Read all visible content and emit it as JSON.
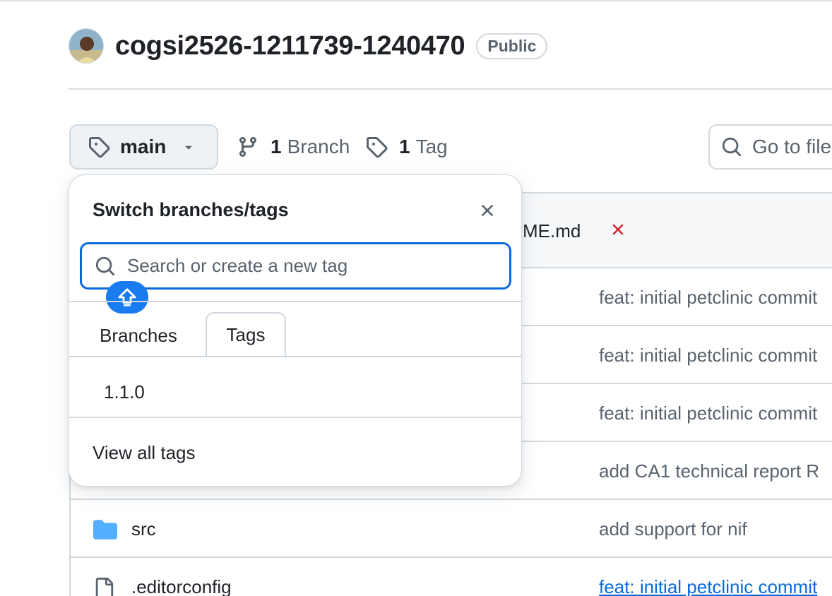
{
  "repo": {
    "name": "cogsi2526-1211739-1240470",
    "visibility": "Public"
  },
  "branch_bar": {
    "current_ref": "main",
    "branch_count": "1",
    "branch_label": "Branch",
    "tag_count": "1",
    "tag_label": "Tag",
    "goto_file_text": "Go to file"
  },
  "file_table": {
    "header_file": "ME.md",
    "rows": [
      {
        "name": "",
        "type": "",
        "message": "feat: initial petclinic commit",
        "link": false
      },
      {
        "name": "",
        "type": "",
        "message": "feat: initial petclinic commit",
        "link": false
      },
      {
        "name": "",
        "type": "",
        "message": "feat: initial petclinic commit",
        "link": false
      },
      {
        "name": "",
        "type": "",
        "message": "add CA1 technical report R",
        "link": false
      },
      {
        "name": "src",
        "type": "folder-icon",
        "message": "add support for nif",
        "link": false
      },
      {
        "name": ".editorconfig",
        "type": "file-icon",
        "message": "feat: initial petclinic commit",
        "link": true
      }
    ]
  },
  "dropdown": {
    "title": "Switch branches/tags",
    "search_placeholder": "Search or create a new tag",
    "tabs": [
      {
        "label": "Branches",
        "selected": false
      },
      {
        "label": "Tags",
        "selected": true
      }
    ],
    "tag_items": [
      "1.1.0"
    ],
    "view_all": "View all tags"
  },
  "colors": {
    "accent": "#0969da",
    "muted_text": "#59636e",
    "border": "#d1d9e0",
    "danger": "#cf222e",
    "folder": "#54aeff"
  }
}
